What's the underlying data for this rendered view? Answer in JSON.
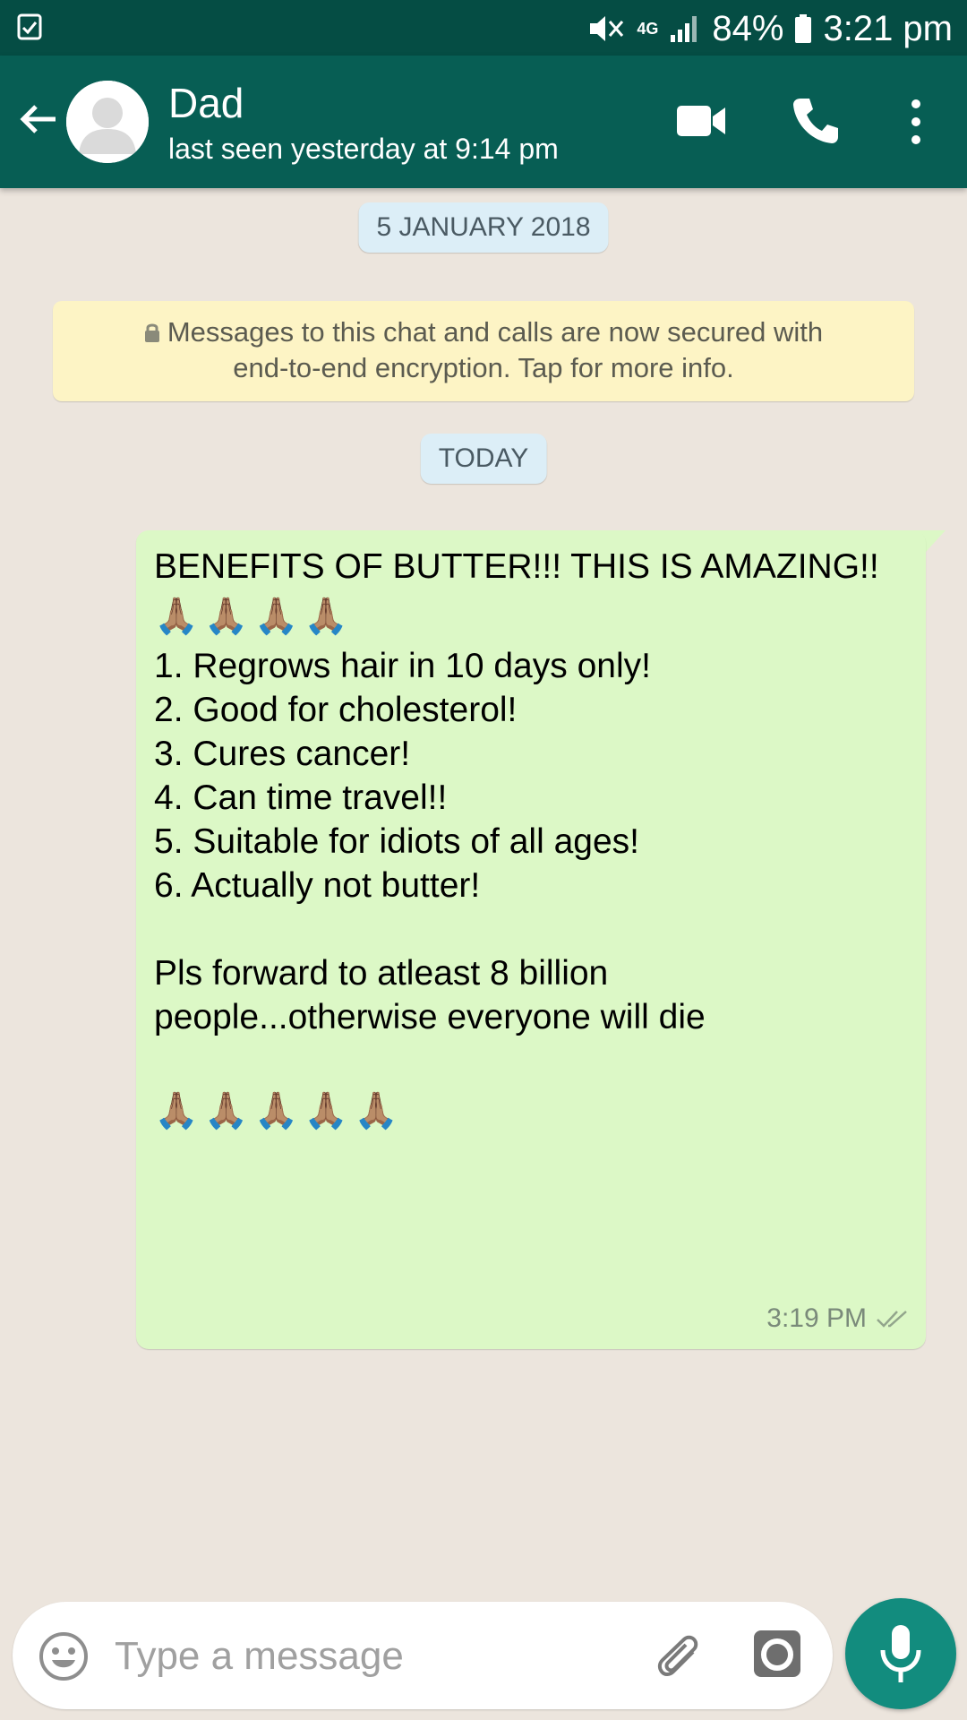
{
  "status_bar": {
    "network": "4G",
    "battery": "84%",
    "time": "3:21 pm"
  },
  "header": {
    "contact_name": "Dad",
    "last_seen": "last seen yesterday at 9:14 pm"
  },
  "chat": {
    "date_separator": "5 JANUARY 2018",
    "encryption_notice": {
      "line1": "Messages to this chat and calls are now secured with",
      "line2": "end-to-end encryption. Tap for more info."
    },
    "today_separator": "TODAY",
    "message": {
      "line1": "BENEFITS OF BUTTER!!! THIS IS AMAZING!!",
      "prayer_line1": "🙏🏽🙏🏽🙏🏽🙏🏽",
      "list": [
        "1. Regrows hair in 10 days only!",
        "2. Good for cholesterol!",
        "3. Cures cancer!",
        "4. Can time travel!!",
        "5. Suitable for idiots of all ages!",
        "6. Actually not butter!"
      ],
      "forward_line1": "Pls forward to atleast 8 billion",
      "forward_line2": "people...otherwise everyone will die",
      "prayer_line2": "🙏🏽🙏🏽🙏🏽🙏🏽🙏🏽",
      "time": "3:19 PM",
      "status": "read"
    }
  },
  "input": {
    "placeholder": "Type a message"
  },
  "colors": {
    "header": "#075E54",
    "status_bar": "#054D44",
    "bubble_out": "#DCF8C6",
    "background": "#ECE5DD",
    "fab": "#128C7E"
  },
  "icons": [
    "back-arrow-icon",
    "avatar-icon",
    "video-call-icon",
    "phone-icon",
    "more-icon",
    "lock-icon",
    "double-check-icon",
    "emoji-icon",
    "paperclip-icon",
    "camera-icon",
    "mic-icon"
  ]
}
